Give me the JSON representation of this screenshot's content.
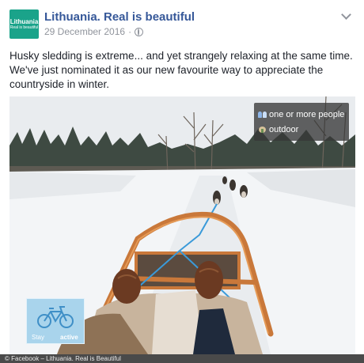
{
  "post": {
    "page_name": "Lithuania. Real is beautiful",
    "date": "29 December 2016",
    "separator": "·",
    "avatar_text_line1": "Lithuania",
    "avatar_text_line2": "Real is beautiful",
    "text_line1": "Husky sledding is extreme... and yet strangely relaxing at the same time.",
    "text_line2": "We've just nominated it as our new favourite way to appreciate the",
    "text_line3": "countryside in winter."
  },
  "photo": {
    "tags": [
      {
        "label": "one or more people",
        "icon": "people-icon"
      },
      {
        "label": "outdoor",
        "icon": "outdoor-icon"
      }
    ],
    "badge": {
      "word1": "Stay",
      "word2": "active",
      "icon": "bicycle-icon"
    }
  },
  "footer": {
    "credit": "© Facebook – Lithuania. Real is Beautiful"
  },
  "colors": {
    "link": "#365899",
    "meta": "#90949c",
    "avatar": "#1aa38a",
    "sled_wood": "#c9783a",
    "rope": "#3a9ad9"
  }
}
